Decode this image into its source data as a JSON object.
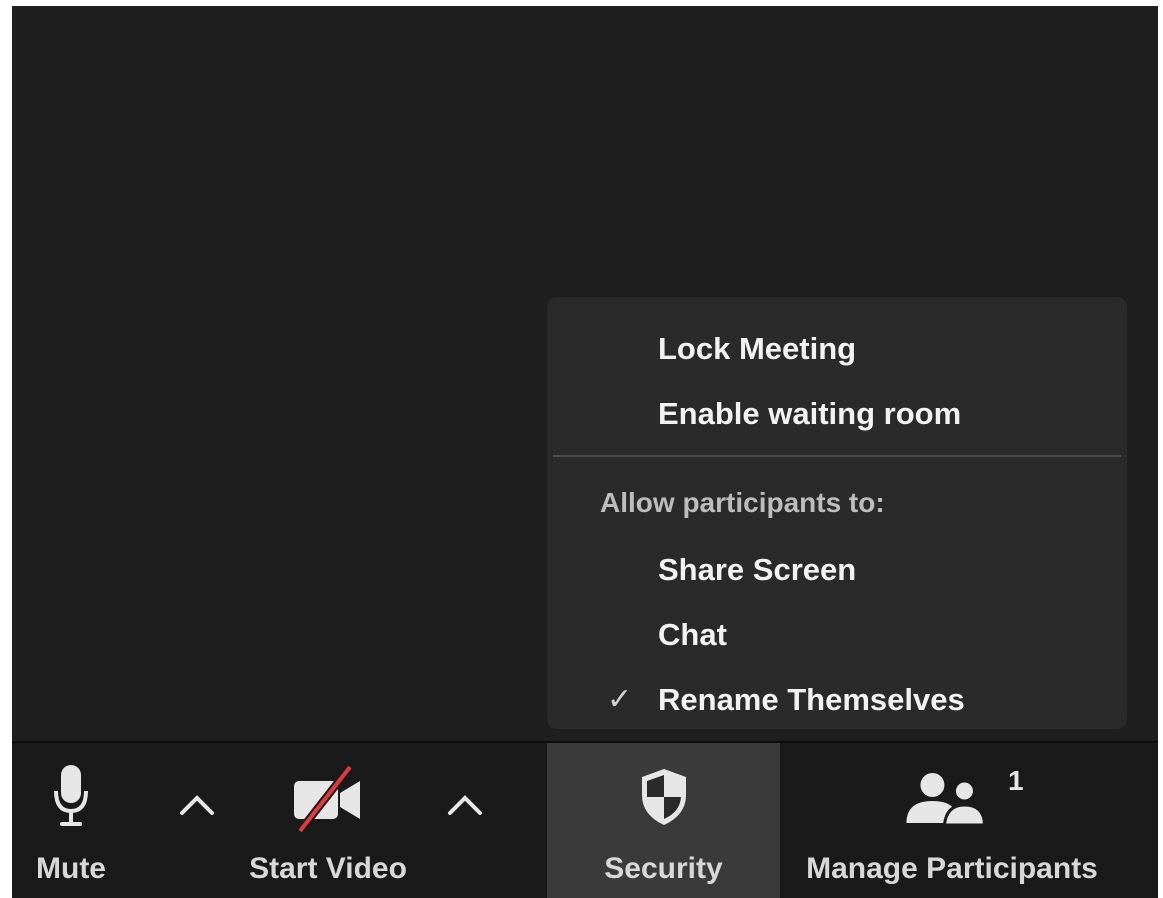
{
  "toolbar": {
    "mute_label": "Mute",
    "start_video_label": "Start Video",
    "security_label": "Security",
    "manage_participants_label": "Manage Participants",
    "participant_count": "1",
    "icons": {
      "mute": "microphone-icon",
      "video": "video-off-icon",
      "security": "shield-icon",
      "participants": "participants-icon",
      "caret": "caret-up-icon"
    }
  },
  "security_menu": {
    "items": [
      {
        "label": "Lock Meeting",
        "checked": false
      },
      {
        "label": "Enable waiting room",
        "checked": false
      }
    ],
    "section_header": "Allow participants to:",
    "permissions": [
      {
        "label": "Share Screen",
        "checked": false
      },
      {
        "label": "Chat",
        "checked": false
      },
      {
        "label": "Rename Themselves",
        "checked": true
      }
    ],
    "check_glyph": "✓"
  },
  "colors": {
    "background": "#1f1f1f",
    "toolbar": "#1a1a1a",
    "menu": "#2a2a2a",
    "active_button": "#3a3a3a",
    "video_off_slash": "#e0393e"
  }
}
